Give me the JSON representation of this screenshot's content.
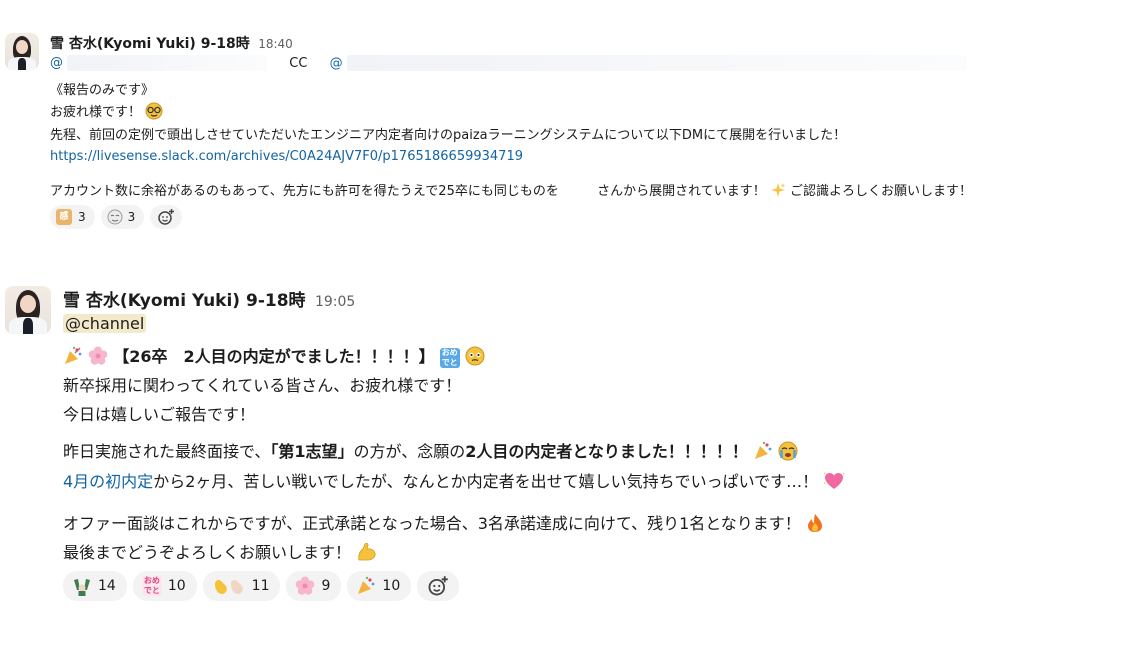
{
  "message1": {
    "author": "雪 杏水(Kyomi Yuki) 9-18時",
    "time": "18:40",
    "at1": "@",
    "cc": "CC",
    "at2": "@",
    "line1": "《報告のみです》",
    "line2": "お疲れ様です！",
    "line3": "先程、前回の定例で頭出しさせていただいたエンジニア内定者向けのpaizaラーニングシステムについて以下DMにて展開を行いました！",
    "link": "https://livesense.slack.com/archives/C0A24AJV7F0/p1765186659934719",
    "line5a": "アカウント数に余裕があるのもあって、先方にも許可を得たうえで25卒にも同じものを",
    "line5b": "さんから展開されています！",
    "line5c": "ご認識よろしくお願いします！",
    "reactions": [
      {
        "icon": "kansha-icon",
        "count": "3"
      },
      {
        "icon": "blush-face-icon",
        "count": "3"
      }
    ]
  },
  "message2": {
    "author": "雪 杏水(Kyomi Yuki) 9-18時",
    "time": "19:05",
    "mention": "@channel",
    "headline": "【26卒　2人目の内定がでました！！！！】",
    "line2": "新卒採用に関わってくれている皆さん、お疲れ様です！",
    "line3": "今日は嬉しいご報告です！",
    "line4a": "昨日実施された最終面接で、",
    "line4b": "「第1志望」",
    "line4c": "の方が、念願の",
    "line4d": "2人目の内定者となりました！！！！！",
    "line5link": "4月の初内定",
    "line5rest": "から2ヶ月、苦しい戦いでしたが、なんとか内定者を出せて嬉しい気持ちでいっぱいです…！",
    "line6": "オファー面談はこれからですが、正式承諾となった場合、3名承諾達成に向けて、残り1名となります！",
    "line7": "最後までどうぞよろしくお願いします！",
    "reactions": [
      {
        "icon": "raised-hands-icon",
        "count": "14"
      },
      {
        "icon": "omedetou-icon",
        "count": "10"
      },
      {
        "icon": "clap-icon",
        "count": "11"
      },
      {
        "icon": "cherry-blossom-icon",
        "count": "9"
      },
      {
        "icon": "party-popper-icon",
        "count": "10"
      }
    ]
  },
  "colors": {
    "link": "#1264a3",
    "mention_bg": "#f2eaca",
    "pill_bg": "#f3f3f3"
  }
}
